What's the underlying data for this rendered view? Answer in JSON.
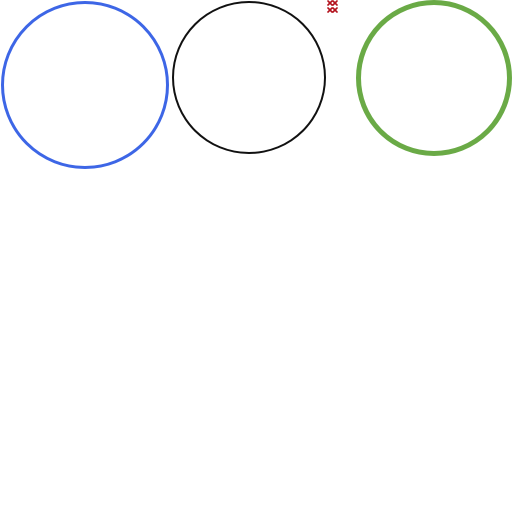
{
  "scene": {
    "background": "#ffffff",
    "rings": [
      {
        "id": "ring-blue",
        "color": "#3d66e6"
      },
      {
        "id": "ring-black",
        "color": "#111111"
      },
      {
        "id": "ring-green",
        "color": "#6aaa46"
      }
    ],
    "marker": {
      "icon": "red-x-glyph-icon",
      "color": "#b3121d"
    }
  }
}
